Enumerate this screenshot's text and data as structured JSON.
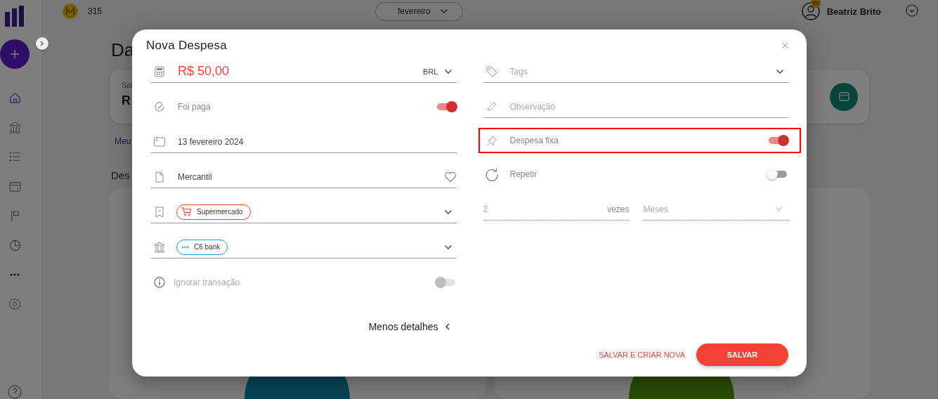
{
  "top_bar": {
    "coins": "315",
    "month_selector": "fevereiro",
    "user_name": "Beatriz Brito"
  },
  "sidebar": {
    "items": [
      {
        "kind": "home",
        "selected": true
      },
      {
        "kind": "bank",
        "selected": false
      },
      {
        "kind": "list",
        "selected": false
      },
      {
        "kind": "wallet",
        "selected": false
      },
      {
        "kind": "flag",
        "selected": false
      },
      {
        "kind": "chart",
        "selected": false
      },
      {
        "kind": "more",
        "selected": false
      },
      {
        "kind": "settings",
        "selected": false
      }
    ]
  },
  "page": {
    "title": "Da",
    "balance_card": {
      "label": "Sal",
      "value": "R"
    },
    "link": "Meu",
    "section_title": "Des"
  },
  "dialog": {
    "title": "Nova Despesa",
    "left_fields": [
      {
        "kind": "amount",
        "value": "R$ 50,00",
        "currency": "BRL"
      },
      {
        "kind": "toggle",
        "label": "Foi paga",
        "on": true,
        "disabled": false
      },
      {
        "kind": "date",
        "value": "13 fevereiro 2024"
      },
      {
        "kind": "text",
        "value": "Mercantil",
        "favorite": false
      },
      {
        "kind": "chip",
        "chip": "Supermercado",
        "color": "#f44336"
      },
      {
        "kind": "chip",
        "chip": "C6 bank",
        "color": "#1e9bd7"
      },
      {
        "kind": "toggle",
        "label": "Ignorar transação",
        "on": false,
        "disabled": true
      }
    ],
    "right_fields": [
      {
        "kind": "select",
        "placeholder": "Tags"
      },
      {
        "kind": "note",
        "placeholder": "Observação"
      },
      {
        "kind": "toggle",
        "label": "Despesa fixa",
        "on": true,
        "disabled": false,
        "highlighted": true
      },
      {
        "kind": "toggle",
        "label": "Repetir",
        "on": false,
        "disabled": false,
        "highlighted": false
      },
      {
        "kind": "repeat",
        "count_placeholder": "2",
        "unit": "vezes",
        "period_placeholder": "Meses"
      }
    ],
    "details_toggle": "Menos detalhes",
    "buttons": [
      {
        "kind": "secondary",
        "label": "SALVAR E CRIAR NOVA"
      },
      {
        "kind": "primary",
        "label": "SALVAR"
      }
    ]
  }
}
